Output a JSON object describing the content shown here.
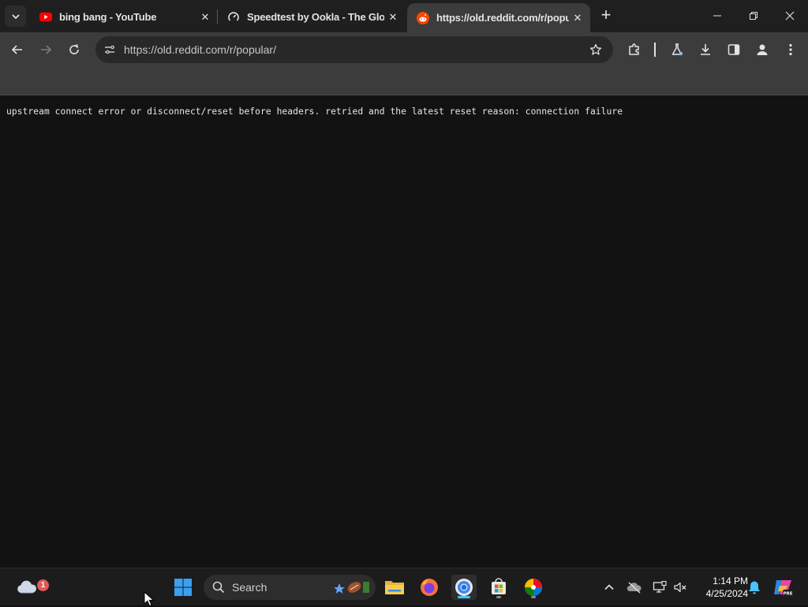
{
  "browser": {
    "tabs": [
      {
        "title": "bing bang - YouTube",
        "icon": "youtube-icon",
        "active": false
      },
      {
        "title": "Speedtest by Ookla - The Glob",
        "icon": "speedtest-icon",
        "active": false
      },
      {
        "title": "https://old.reddit.com/r/popul",
        "icon": "reddit-icon",
        "active": true
      }
    ],
    "url": "https://old.reddit.com/r/popular/"
  },
  "page": {
    "error_message": "upstream connect error or disconnect/reset before headers. retried and the latest reset reason: connection failure"
  },
  "taskbar": {
    "weather_badge": "1",
    "search_label": "Search",
    "time": "1:14 PM",
    "date": "4/25/2024"
  },
  "colors": {
    "accent": "#4cc2ff",
    "youtube": "#ff0000",
    "reddit": "#ff4500"
  }
}
